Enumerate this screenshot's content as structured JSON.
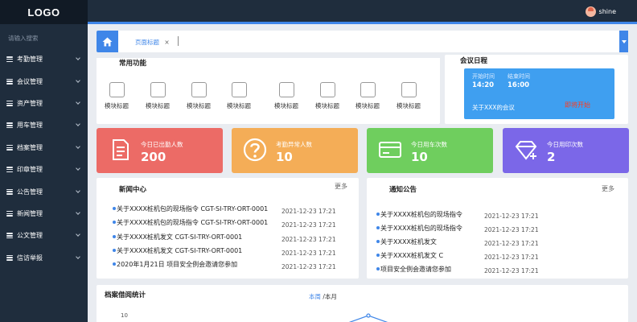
{
  "app": {
    "logo": "LOGO"
  },
  "sidebar": {
    "search_placeholder": "请输入搜索",
    "items": [
      {
        "label": "考勤管理"
      },
      {
        "label": "会议管理"
      },
      {
        "label": "资产管理"
      },
      {
        "label": "用车管理"
      },
      {
        "label": "档案管理"
      },
      {
        "label": "印章管理"
      },
      {
        "label": "公告管理"
      },
      {
        "label": "新闻管理"
      },
      {
        "label": "公文管理"
      },
      {
        "label": "信访举报"
      }
    ]
  },
  "header": {
    "username": "shine",
    "accent_color": "#3f86e8"
  },
  "tabs": {
    "active_label": "页面标题",
    "close_glyph": "×"
  },
  "common_functions": {
    "title": "常用功能",
    "modules": [
      {
        "label": "模块标题"
      },
      {
        "label": "模块标题"
      },
      {
        "label": "模块标题"
      },
      {
        "label": "模块标题"
      },
      {
        "label": "模块标题"
      },
      {
        "label": "模块标题"
      },
      {
        "label": "模块标题"
      },
      {
        "label": "模块标题"
      }
    ]
  },
  "meeting_schedule": {
    "title": "会议日程",
    "start_label": "开始时间",
    "start_time": "14:20",
    "end_label": "结束时间",
    "end_time": "16:00",
    "meeting_title": "关于XXX的会议",
    "join_label": "即将开始"
  },
  "stats": [
    {
      "label": "今日已出勤人数",
      "value": "200",
      "color": "#ec6b66",
      "icon": "document-icon"
    },
    {
      "label": "考勤异常人数",
      "value": "10",
      "color": "#f4ad57",
      "icon": "question-icon"
    },
    {
      "label": "今日用车次数",
      "value": "10",
      "color": "#6fce5e",
      "icon": "card-icon"
    },
    {
      "label": "今日用印次数",
      "value": "2",
      "color": "#7b67e8",
      "icon": "seal-icon"
    }
  ],
  "news": {
    "title": "新闻中心",
    "more_label": "更多",
    "items": [
      {
        "text": "关于XXXX桩机包的现场指令  CGT-SI-TRY-ORT-0001",
        "date": "2021-12-23  17:21"
      },
      {
        "text": "关于XXXX桩机包的现场指令  CGT-SI-TRY-ORT-0001",
        "date": "2021-12-23  17:21"
      },
      {
        "text": "关于XXXX桩机发文  CGT-SI-TRY-ORT-0001",
        "date": "2021-12-23  17:21"
      },
      {
        "text": "关于XXXX桩机发文  CGT-SI-TRY-ORT-0001",
        "date": "2021-12-23  17:21"
      },
      {
        "text": "2020年1月21日  项目安全例会邀请您参加",
        "date": "2021-12-23  17:21"
      }
    ]
  },
  "notices": {
    "title": "通知公告",
    "more_label": "更多",
    "items": [
      {
        "text": "关于XXXX桩机包的现场指令",
        "date": "2021-12-23  17:21"
      },
      {
        "text": "关于XXXX桩机包的现场指令",
        "date": "2021-12-23  17:21"
      },
      {
        "text": "关于XXXX桩机发文",
        "date": "2021-12-23  17:21"
      },
      {
        "text": "关于XXXX桩机发文 C",
        "date": "2021-12-23  17:21"
      },
      {
        "text": "项目安全例会邀请您参加",
        "date": "2021-12-23  17:21"
      }
    ]
  },
  "archive_stats": {
    "title": "档案借阅统计",
    "toggle_week": "本周",
    "toggle_sep": " /",
    "toggle_month": "本月",
    "y_tick_top": "10"
  }
}
